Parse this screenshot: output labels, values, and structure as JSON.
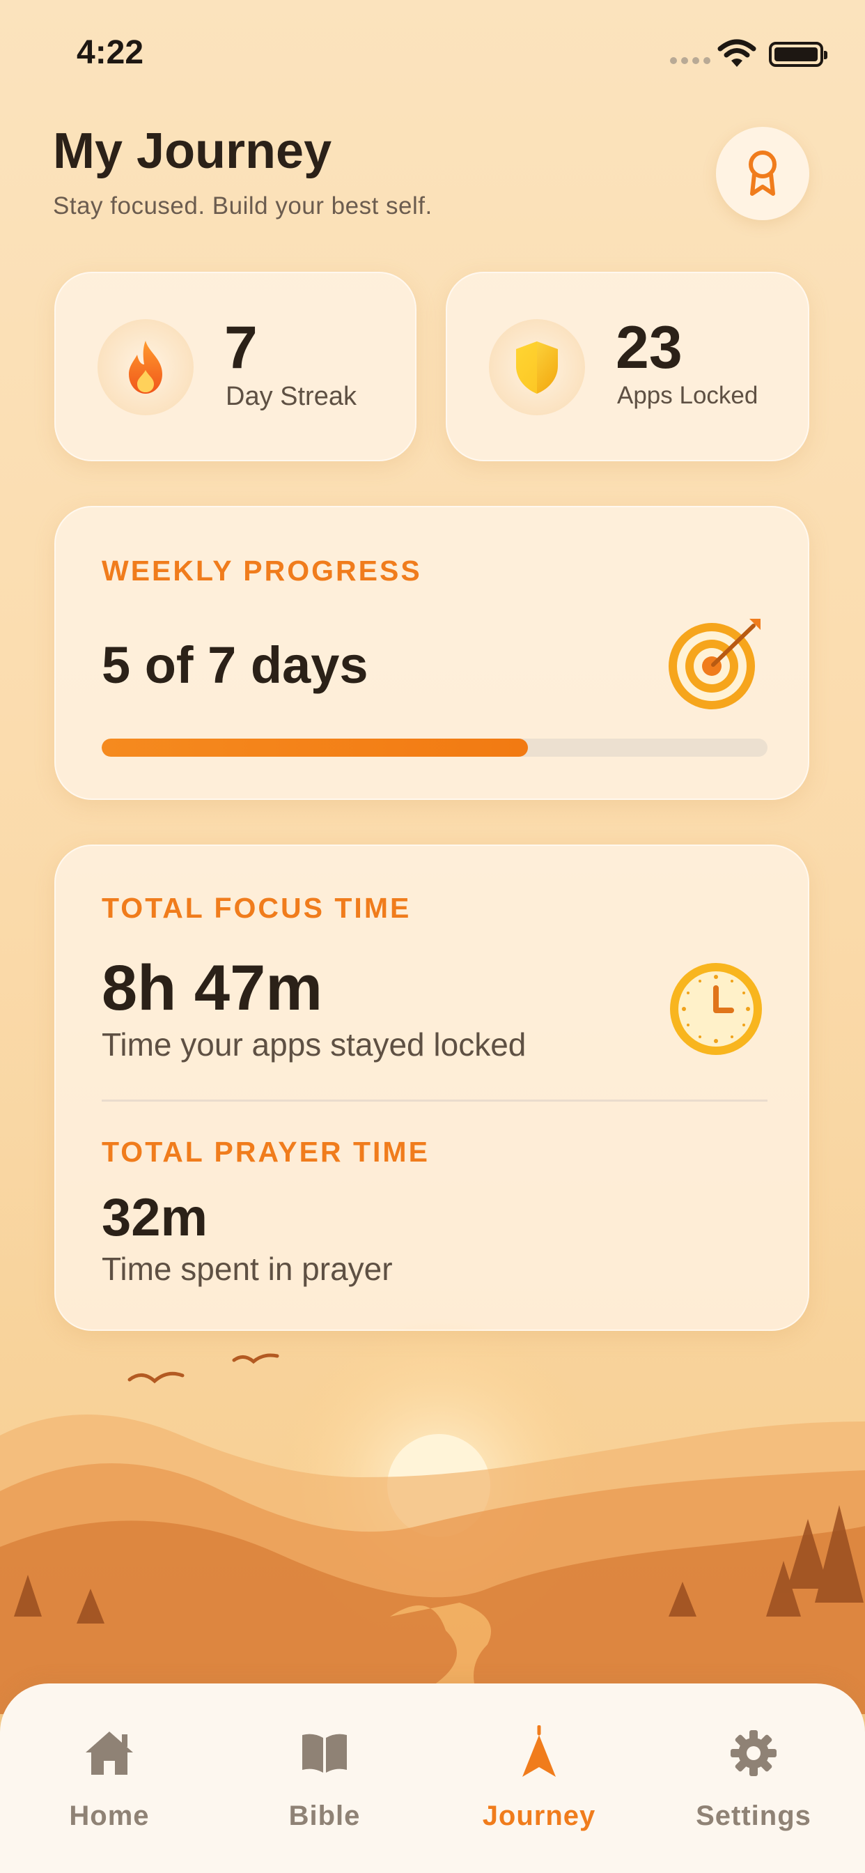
{
  "status_bar": {
    "time": "4:22"
  },
  "header": {
    "title": "My Journey",
    "subtitle": "Stay focused. Build your best self.",
    "badge_icon": "ribbon-award-icon"
  },
  "stats": {
    "streak": {
      "value": "7",
      "label": "Day Streak",
      "icon": "flame-icon"
    },
    "apps_locked": {
      "value": "23",
      "label": "Apps Locked",
      "icon": "shield-icon"
    }
  },
  "weekly_progress": {
    "label": "WEEKLY PROGRESS",
    "value": "5 of 7 days",
    "progress_fraction": 0.64,
    "icon": "target-icon"
  },
  "focus": {
    "focus_label": "TOTAL FOCUS TIME",
    "focus_value": "8h 47m",
    "focus_desc": "Time your apps stayed locked",
    "prayer_label": "TOTAL PRAYER TIME",
    "prayer_value": "32m",
    "prayer_desc": "Time spent in prayer",
    "icon": "clock-icon"
  },
  "tabs": [
    {
      "label": "Home",
      "icon": "home-icon",
      "active": false
    },
    {
      "label": "Bible",
      "icon": "book-icon",
      "active": false
    },
    {
      "label": "Journey",
      "icon": "compass-arrow-icon",
      "active": true
    },
    {
      "label": "Settings",
      "icon": "gear-icon",
      "active": false
    }
  ],
  "colors": {
    "accent": "#f07c1c",
    "background": "#fbdcae",
    "card": "#fff4e6",
    "text": "#2b2118",
    "inactive_tab": "#8f8275"
  }
}
